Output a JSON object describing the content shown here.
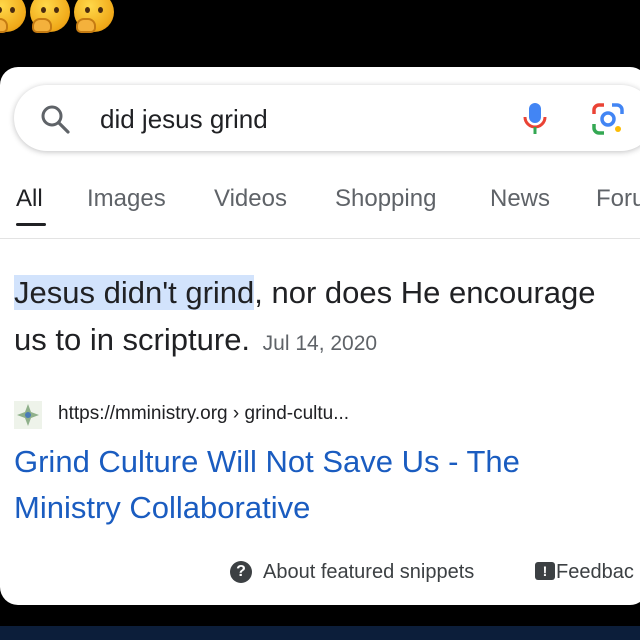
{
  "emojis": [
    "thinking-face-emoji",
    "thinking-face-emoji",
    "thinking-face-emoji"
  ],
  "search": {
    "query": "did jesus grind"
  },
  "tabs": [
    {
      "label": "All",
      "active": true
    },
    {
      "label": "Images"
    },
    {
      "label": "Videos"
    },
    {
      "label": "Shopping"
    },
    {
      "label": "News"
    },
    {
      "label": "Foru"
    }
  ],
  "snippet": {
    "highlight": "Jesus didn't grind",
    "rest": ", nor does He encourage us to in scripture.",
    "date": "Jul 14, 2020"
  },
  "result": {
    "url": "https://mministry.org › grind-cultu...",
    "title": "Grind Culture Will Not Save Us - The Ministry Collaborative"
  },
  "footer": {
    "about": "About featured snippets",
    "feedback": "Feedbac"
  },
  "colors": {
    "link": "#1a5cc0",
    "highlight": "#d2e3fc"
  }
}
